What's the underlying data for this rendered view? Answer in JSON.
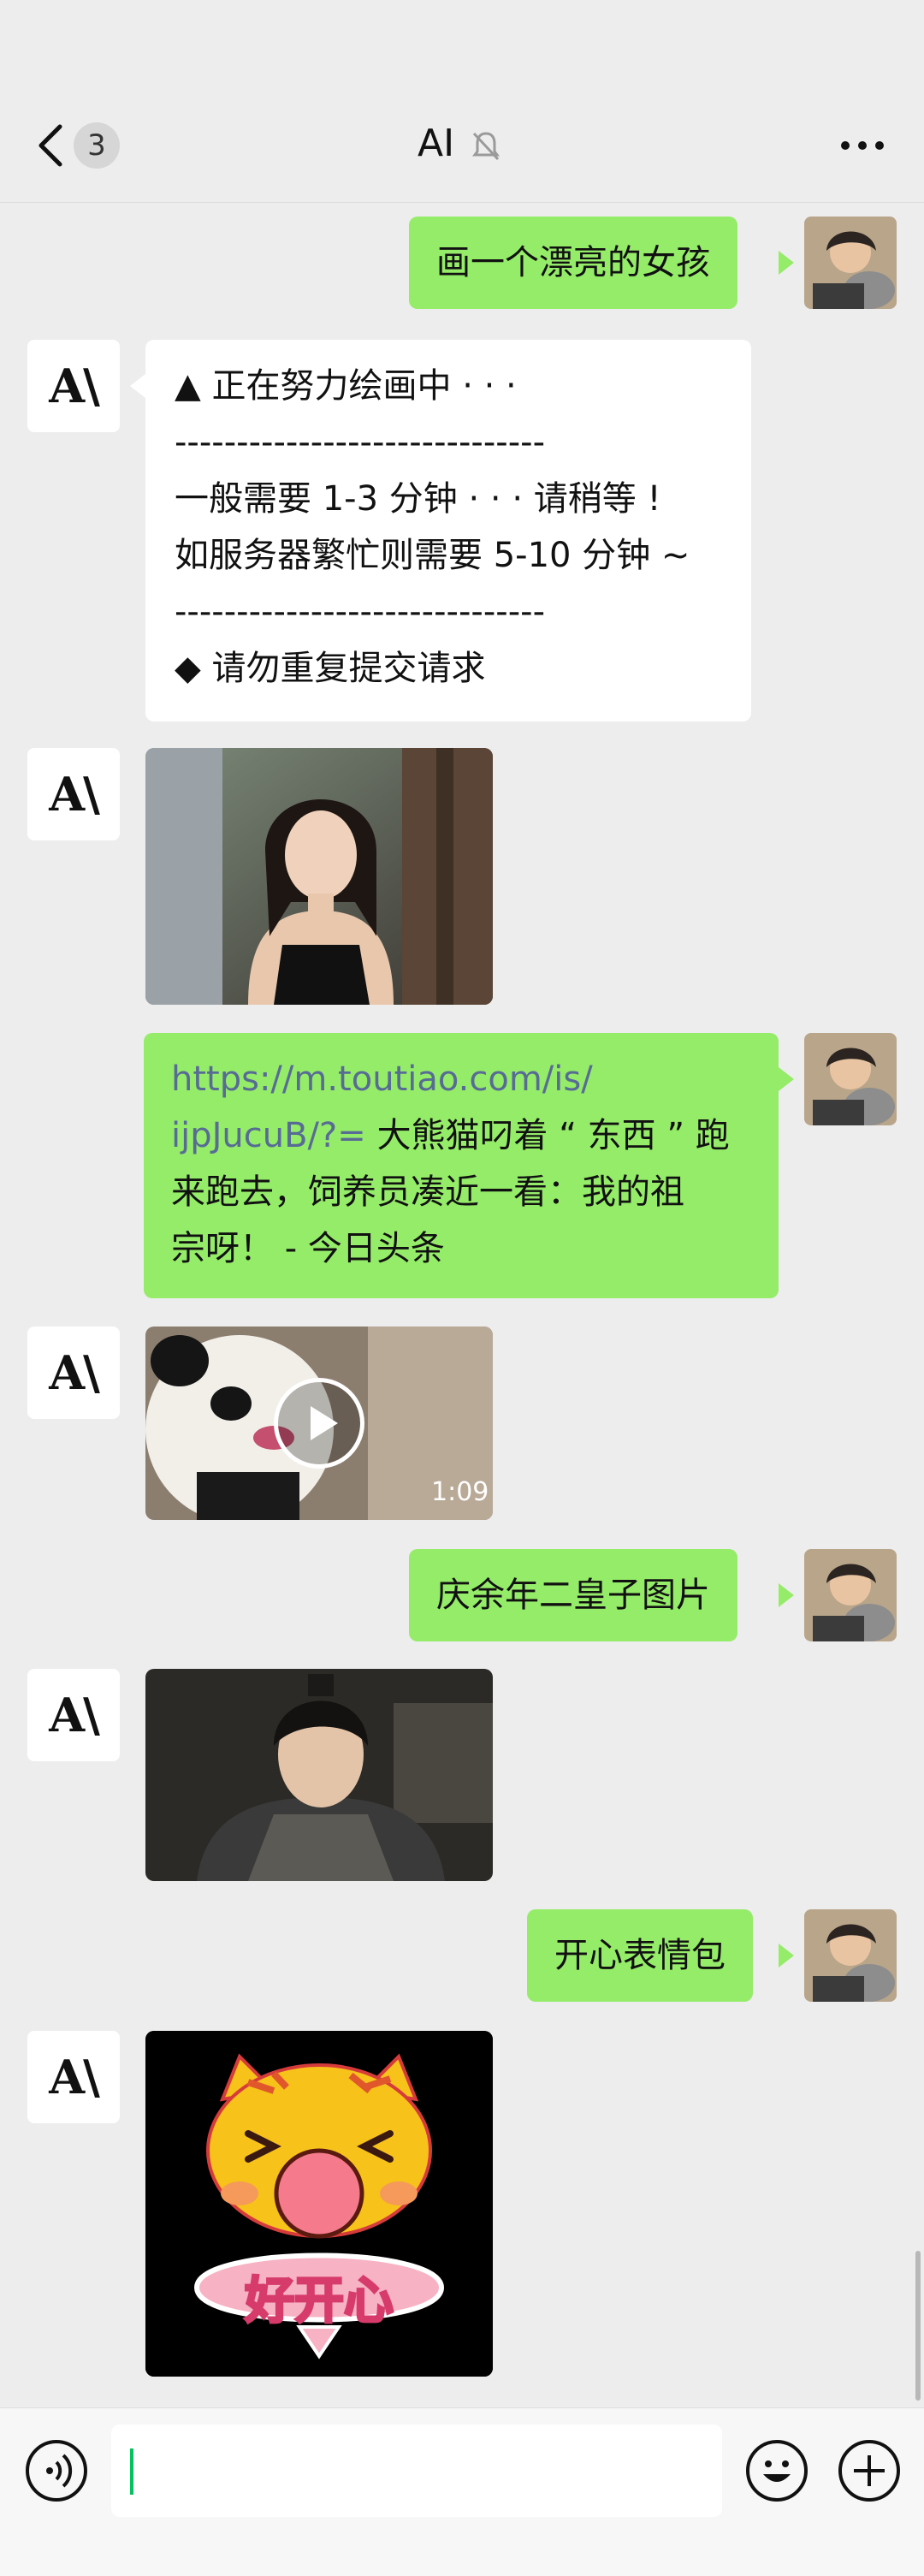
{
  "header": {
    "back_label": "<",
    "unread_badge": "3",
    "title": "AI",
    "bell_icon": "muted-bell-icon",
    "more_icon": "ellipsis-icon"
  },
  "ai": {
    "logo_text": "A\\"
  },
  "messages": [
    {
      "side": "me",
      "type": "text",
      "text": "画一个漂亮的女孩"
    },
    {
      "side": "ai",
      "type": "text",
      "lines": [
        "▲ 正在努力绘画中 · · ·",
        "------------------------------",
        "一般需要 1-3 分钟 · · · 请稍等 !",
        "如服务器繁忙则需要 5-10 分钟 ~",
        "------------------------------",
        "◆ 请勿重复提交请求"
      ]
    },
    {
      "side": "ai",
      "type": "image",
      "image": "ai-generated-girl-image"
    },
    {
      "side": "me",
      "type": "link-text",
      "link_line1": "https://m.toutiao.com/is/",
      "link_line2": "ijpJucuB/?=",
      "line2_rest": " 大熊猫叼着 “ 东西 ” 跑",
      "line3": "来跑去，饲养员凑近一看：我的祖",
      "line4": "宗呀！ - 今日头条"
    },
    {
      "side": "ai",
      "type": "video",
      "image": "panda-video-thumbnail",
      "duration": "1:09"
    },
    {
      "side": "me",
      "type": "text",
      "text": "庆余年二皇子图片"
    },
    {
      "side": "ai",
      "type": "image",
      "image": "second-prince-image"
    },
    {
      "side": "me",
      "type": "text",
      "text": "开心表情包"
    },
    {
      "side": "ai",
      "type": "image",
      "image": "happy-sticker-image",
      "sticker_text": "好开心"
    }
  ],
  "input_bar": {
    "voice_icon": "voice-icon",
    "emoji_icon": "emoji-icon",
    "plus_icon": "plus-icon",
    "input_value": ""
  }
}
